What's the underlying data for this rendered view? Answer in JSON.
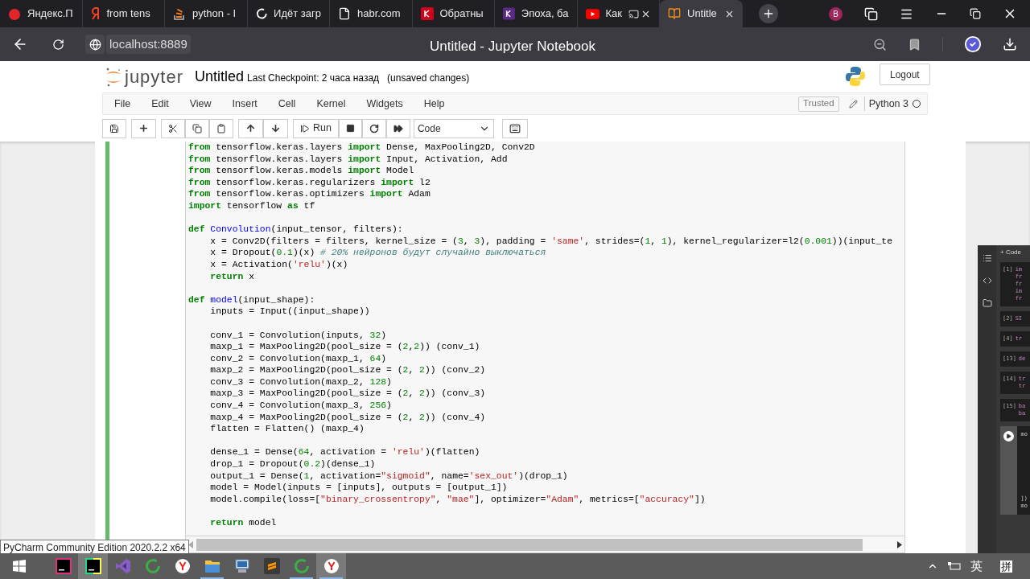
{
  "browser": {
    "tabs": [
      {
        "title": "Яндекс.П",
        "kind": "badge",
        "color": "#e0262b",
        "selected": false,
        "closable": false
      },
      {
        "title": "from tens",
        "kind": "ya",
        "color": "#fc3f1d",
        "selected": false,
        "closable": false
      },
      {
        "title": "python - I",
        "kind": "stack",
        "color": "#f48024",
        "selected": false,
        "closable": false
      },
      {
        "title": "Идёт загр",
        "kind": "spinner",
        "color": "#ffffff",
        "selected": false,
        "closable": false
      },
      {
        "title": "habr.com",
        "kind": "page",
        "color": "#ffffff",
        "selected": false,
        "closable": false
      },
      {
        "title": "Обратны",
        "kind": "square",
        "color": "#d0021b",
        "selected": false,
        "closable": false
      },
      {
        "title": "Эпоха, ба",
        "kind": "square",
        "color": "#5b2a86",
        "selected": false,
        "closable": false
      },
      {
        "title": "Как",
        "kind": "play",
        "color": "#ff0000",
        "selected": false,
        "closable": true
      },
      {
        "title": "Untitle",
        "kind": "book",
        "color": "#f08c1a",
        "selected": true,
        "closable": true
      }
    ],
    "profile_initial": "B",
    "address": "localhost:8889",
    "page_title": "Untitled - Jupyter Notebook"
  },
  "notebook": {
    "brand": "jupyter",
    "name": "Untitled",
    "checkpoint": "Last Checkpoint: 2 часа назад",
    "status": "(unsaved changes)",
    "logout": "Logout",
    "menu": [
      "File",
      "Edit",
      "View",
      "Insert",
      "Cell",
      "Kernel",
      "Widgets",
      "Help"
    ],
    "trusted": "Trusted",
    "kernel": "Python 3",
    "kernel_busy": false,
    "run": "Run",
    "cell_type": "Code",
    "edit_mode": true
  },
  "code_blocks": [
    [
      [
        {
          "kind": "kw",
          "text": "from"
        },
        {
          "kind": "p",
          "text": " tensorflow.keras.layers "
        },
        {
          "kind": "kw",
          "text": "import"
        },
        {
          "kind": "p",
          "text": " Dense, MaxPooling2D, Conv2D"
        }
      ],
      [
        {
          "kind": "kw",
          "text": "from"
        },
        {
          "kind": "p",
          "text": " tensorflow.keras.layers "
        },
        {
          "kind": "kw",
          "text": "import"
        },
        {
          "kind": "p",
          "text": " Input, Activation, Add"
        }
      ],
      [
        {
          "kind": "kw",
          "text": "from"
        },
        {
          "kind": "p",
          "text": " tensorflow.keras.models "
        },
        {
          "kind": "kw",
          "text": "import"
        },
        {
          "kind": "p",
          "text": " Model"
        }
      ],
      [
        {
          "kind": "kw",
          "text": "from"
        },
        {
          "kind": "p",
          "text": " tensorflow.keras.regularizers "
        },
        {
          "kind": "kw",
          "text": "import"
        },
        {
          "kind": "p",
          "text": " l2"
        }
      ],
      [
        {
          "kind": "kw",
          "text": "from"
        },
        {
          "kind": "p",
          "text": " tensorflow.keras.optimizers "
        },
        {
          "kind": "kw",
          "text": "import"
        },
        {
          "kind": "p",
          "text": " Adam"
        }
      ],
      [
        {
          "kind": "kw",
          "text": "import"
        },
        {
          "kind": "p",
          "text": " tensorflow "
        },
        {
          "kind": "kw",
          "text": "as"
        },
        {
          "kind": "p",
          "text": " tf"
        }
      ]
    ],
    [
      [
        {
          "kind": "kw",
          "text": "def"
        },
        {
          "kind": "def",
          "text": " Convolution"
        },
        {
          "kind": "p",
          "text": "(input_tensor, filters):"
        }
      ],
      [
        {
          "kind": "p",
          "text": "    x = Conv2D(filters = filters, kernel_size = ("
        },
        {
          "kind": "num",
          "text": "3"
        },
        {
          "kind": "p",
          "text": ", "
        },
        {
          "kind": "num",
          "text": "3"
        },
        {
          "kind": "p",
          "text": "), padding = "
        },
        {
          "kind": "str",
          "text": "'same'"
        },
        {
          "kind": "p",
          "text": ", strides=("
        },
        {
          "kind": "num",
          "text": "1"
        },
        {
          "kind": "p",
          "text": ", "
        },
        {
          "kind": "num",
          "text": "1"
        },
        {
          "kind": "p",
          "text": "), kernel_regularizer=l2("
        },
        {
          "kind": "num",
          "text": "0.001"
        },
        {
          "kind": "p",
          "text": "))(input_te"
        }
      ],
      [
        {
          "kind": "p",
          "text": "    x = Dropout("
        },
        {
          "kind": "num",
          "text": "0.1"
        },
        {
          "kind": "p",
          "text": ")(x) "
        },
        {
          "kind": "cm",
          "text": "# 20% нейронов будут случайно выключаться"
        }
      ],
      [
        {
          "kind": "p",
          "text": "    x = Activation("
        },
        {
          "kind": "str",
          "text": "'relu'"
        },
        {
          "kind": "p",
          "text": ")(x)"
        }
      ],
      [
        {
          "kind": "kw",
          "text": "    return"
        },
        {
          "kind": "p",
          "text": " x"
        }
      ]
    ],
    [
      [
        {
          "kind": "kw",
          "text": "def"
        },
        {
          "kind": "def",
          "text": " model"
        },
        {
          "kind": "p",
          "text": "(input_shape):"
        }
      ],
      [
        {
          "kind": "p",
          "text": "    inputs = Input((input_shape))"
        }
      ]
    ],
    [
      [
        {
          "kind": "p",
          "text": "    conv_1 = Convolution(inputs, "
        },
        {
          "kind": "num",
          "text": "32"
        },
        {
          "kind": "p",
          "text": ")"
        }
      ],
      [
        {
          "kind": "p",
          "text": "    maxp_1 = MaxPooling2D(pool_size = ("
        },
        {
          "kind": "num",
          "text": "2"
        },
        {
          "kind": "p",
          "text": ","
        },
        {
          "kind": "num",
          "text": "2"
        },
        {
          "kind": "p",
          "text": ")) (conv_1)"
        }
      ],
      [
        {
          "kind": "p",
          "text": "    conv_2 = Convolution(maxp_1, "
        },
        {
          "kind": "num",
          "text": "64"
        },
        {
          "kind": "p",
          "text": ")"
        }
      ],
      [
        {
          "kind": "p",
          "text": "    maxp_2 = MaxPooling2D(pool_size = ("
        },
        {
          "kind": "num",
          "text": "2"
        },
        {
          "kind": "p",
          "text": ", "
        },
        {
          "kind": "num",
          "text": "2"
        },
        {
          "kind": "p",
          "text": ")) (conv_2)"
        }
      ],
      [
        {
          "kind": "p",
          "text": "    conv_3 = Convolution(maxp_2, "
        },
        {
          "kind": "num",
          "text": "128"
        },
        {
          "kind": "p",
          "text": ")"
        }
      ],
      [
        {
          "kind": "p",
          "text": "    maxp_3 = MaxPooling2D(pool_size = ("
        },
        {
          "kind": "num",
          "text": "2"
        },
        {
          "kind": "p",
          "text": ", "
        },
        {
          "kind": "num",
          "text": "2"
        },
        {
          "kind": "p",
          "text": ")) (conv_3)"
        }
      ],
      [
        {
          "kind": "p",
          "text": "    conv_4 = Convolution(maxp_3, "
        },
        {
          "kind": "num",
          "text": "256"
        },
        {
          "kind": "p",
          "text": ")"
        }
      ],
      [
        {
          "kind": "p",
          "text": "    maxp_4 = MaxPooling2D(pool_size = ("
        },
        {
          "kind": "num",
          "text": "2"
        },
        {
          "kind": "p",
          "text": ", "
        },
        {
          "kind": "num",
          "text": "2"
        },
        {
          "kind": "p",
          "text": ")) (conv_4)"
        }
      ],
      [
        {
          "kind": "p",
          "text": "    flatten = Flatten() (maxp_4)"
        }
      ]
    ],
    [
      [
        {
          "kind": "p",
          "text": "    dense_1 = Dense("
        },
        {
          "kind": "num",
          "text": "64"
        },
        {
          "kind": "p",
          "text": ", activation = "
        },
        {
          "kind": "str",
          "text": "'relu'"
        },
        {
          "kind": "p",
          "text": ")(flatten)"
        }
      ],
      [
        {
          "kind": "p",
          "text": "    drop_1 = Dropout("
        },
        {
          "kind": "num",
          "text": "0.2"
        },
        {
          "kind": "p",
          "text": ")(dense_1)"
        }
      ],
      [
        {
          "kind": "p",
          "text": "    output_1 = Dense("
        },
        {
          "kind": "num",
          "text": "1"
        },
        {
          "kind": "p",
          "text": ", activation="
        },
        {
          "kind": "str",
          "text": "\"sigmoid\""
        },
        {
          "kind": "p",
          "text": ", name="
        },
        {
          "kind": "str",
          "text": "'sex_out'"
        },
        {
          "kind": "p",
          "text": ")(drop_1)"
        }
      ],
      [
        {
          "kind": "p",
          "text": "    model = Model(inputs = [inputs], outputs = [output_1])"
        }
      ],
      [
        {
          "kind": "p",
          "text": "    model.compile(loss=["
        },
        {
          "kind": "str",
          "text": "\"binary_crossentropy\""
        },
        {
          "kind": "p",
          "text": ", "
        },
        {
          "kind": "str",
          "text": "\"mae\""
        },
        {
          "kind": "p",
          "text": "], optimizer="
        },
        {
          "kind": "str",
          "text": "\"Adam\""
        },
        {
          "kind": "p",
          "text": ", metrics=["
        },
        {
          "kind": "str",
          "text": "\"accuracy\""
        },
        {
          "kind": "p",
          "text": "])"
        }
      ]
    ],
    [
      [
        {
          "kind": "kw",
          "text": "    return"
        },
        {
          "kind": "p",
          "text": " model"
        }
      ]
    ]
  ],
  "side_panel": {
    "add": "+ Code",
    "cells": [
      {
        "kind": "done",
        "label": "[1]",
        "lines": [
          "im",
          "fr",
          "fr",
          "im",
          "fr"
        ]
      },
      {
        "kind": "done",
        "label": "[2]",
        "lines": [
          "SI"
        ]
      },
      {
        "kind": "done",
        "label": "[4]",
        "lines": [
          "tr"
        ]
      },
      {
        "kind": "done",
        "label": "[13]",
        "lines": [
          "de"
        ]
      },
      {
        "kind": "done",
        "label": "[14]",
        "lines": [
          "tr",
          "tr"
        ]
      },
      {
        "kind": "done",
        "label": "[15]",
        "lines": [
          "ba",
          "ba"
        ]
      },
      {
        "kind": "run",
        "lines": [
          "mo",
          "])",
          "mo"
        ]
      }
    ]
  },
  "tooltip": "PyCharm Community Edition 2020.2.2 x64",
  "taskbar": {
    "apps": [
      {
        "kind": "intellij",
        "selected": false,
        "running": false
      },
      {
        "kind": "pycharm",
        "selected": true,
        "running": false
      },
      {
        "kind": "vs",
        "selected": false,
        "running": false
      },
      {
        "kind": "ring",
        "selected": false,
        "running": false
      },
      {
        "kind": "yandex",
        "selected": false,
        "running": false
      },
      {
        "kind": "folder",
        "selected": false,
        "running": true
      },
      {
        "kind": "network",
        "selected": false,
        "running": false
      },
      {
        "kind": "sublime",
        "selected": false,
        "running": false
      },
      {
        "kind": "ring",
        "selected": false,
        "running": true
      },
      {
        "kind": "yandex",
        "selected": true,
        "running": true
      }
    ],
    "ime": "英",
    "input_method": "拼"
  }
}
